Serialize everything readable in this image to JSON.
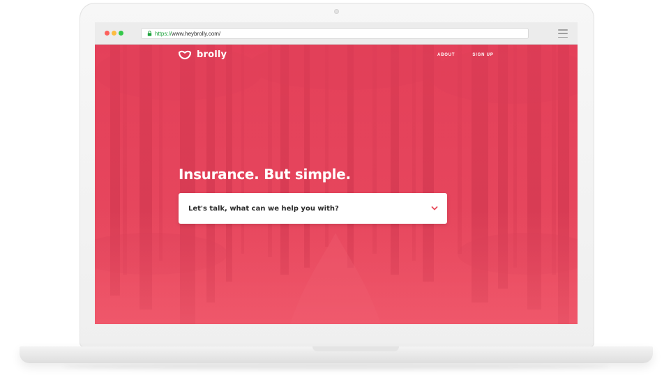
{
  "browser": {
    "url_protocol": "https://",
    "url_host": "www.heybrolly.com/"
  },
  "site": {
    "logo_text": "brolly",
    "nav": [
      {
        "label": "ABOUT"
      },
      {
        "label": "SIGN UP"
      }
    ],
    "hero_title": "Insurance. But simple.",
    "help_select": {
      "selected_text": "Let's talk, what can we help you with?"
    },
    "colors": {
      "brand": "#e9455b",
      "accent": "#e84b5a"
    }
  }
}
